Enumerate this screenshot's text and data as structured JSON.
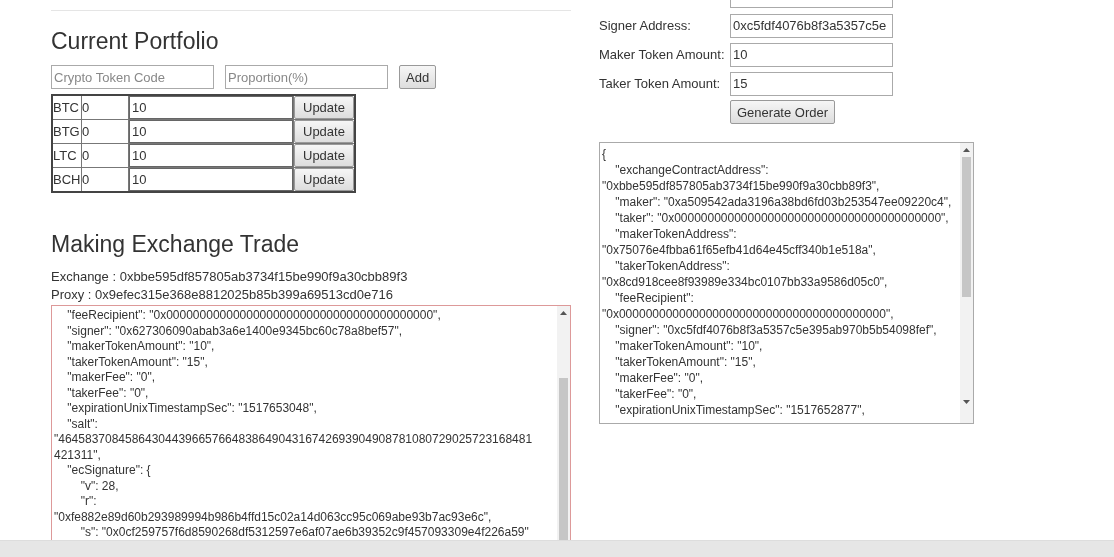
{
  "portfolio": {
    "title": "Current Portfolio",
    "token_placeholder": "Crypto Token Code",
    "proportion_placeholder": "Proportion(%)",
    "add_button": "Add",
    "rows": [
      {
        "code": "BTC",
        "amount": "0",
        "proportion": "10",
        "button": "Update"
      },
      {
        "code": "BTG",
        "amount": "0",
        "proportion": "10",
        "button": "Update"
      },
      {
        "code": "LTC",
        "amount": "0",
        "proportion": "10",
        "button": "Update"
      },
      {
        "code": "BCH",
        "amount": "0",
        "proportion": "10",
        "button": "Update"
      }
    ]
  },
  "trade": {
    "title": "Making Exchange Trade",
    "exchange": "Exchange : 0xbbe595df857805ab3734f15be990f9a30cbb89f3",
    "proxy": "Proxy : 0x9efec315e368e8812025b85b399a69513cd0e716",
    "output_lines": [
      "    \"feeRecipient\": \"0x0000000000000000000000000000000000000000\",",
      "    \"signer\": \"0x627306090abab3a6e1400e9345bc60c78a8bef57\",",
      "    \"makerTokenAmount\": \"10\",",
      "    \"takerTokenAmount\": \"15\",",
      "    \"makerFee\": \"0\",",
      "    \"takerFee\": \"0\",",
      "    \"expirationUnixTimestampSec\": \"1517653048\",",
      "    \"salt\":",
      "\"46458370845864304439665766483864904316742693904908781080729025723168481",
      "421311\",",
      "    \"ecSignature\": {",
      "        \"v\": 28,",
      "        \"r\":",
      "\"0xfe882e89d60b293989994b986b4ffd15c02a14d063cc95c069abe93b7ac93e6c\",",
      "        \"s\": \"0x0cf259757f6d8590268df5312597e6af07ae6b39352c9f457093309e4f226a59\""
    ]
  },
  "order_form": {
    "fields": [
      {
        "label": "Signer Address:",
        "value": "0xc5fdf4076b8f3a5357c5e"
      },
      {
        "label": "Maker Token Amount:",
        "value": "10"
      },
      {
        "label": "Taker Token Amount:",
        "value": "15"
      }
    ],
    "generate_button": "Generate Order",
    "output_lines": [
      "{",
      "    \"exchangeContractAddress\":",
      "\"0xbbe595df857805ab3734f15be990f9a30cbb89f3\",",
      "    \"maker\": \"0xa509542ada3196a38bd6fd03b253547ee09220c4\",",
      "    \"taker\": \"0x0000000000000000000000000000000000000000\",",
      "    \"makerTokenAddress\":",
      "\"0x75076e4fbba61f65efb41d64e45cff340b1e518a\",",
      "    \"takerTokenAddress\":",
      "\"0x8cd918cee8f93989e334bc0107bb33a9586d05c0\",",
      "    \"feeRecipient\":",
      "\"0x0000000000000000000000000000000000000000\",",
      "    \"signer\": \"0xc5fdf4076b8f3a5357c5e395ab970b5b54098fef\",",
      "    \"makerTokenAmount\": \"10\",",
      "    \"takerTokenAmount\": \"15\",",
      "    \"makerFee\": \"0\",",
      "    \"takerFee\": \"0\",",
      "    \"expirationUnixTimestampSec\": \"1517652877\","
    ]
  }
}
